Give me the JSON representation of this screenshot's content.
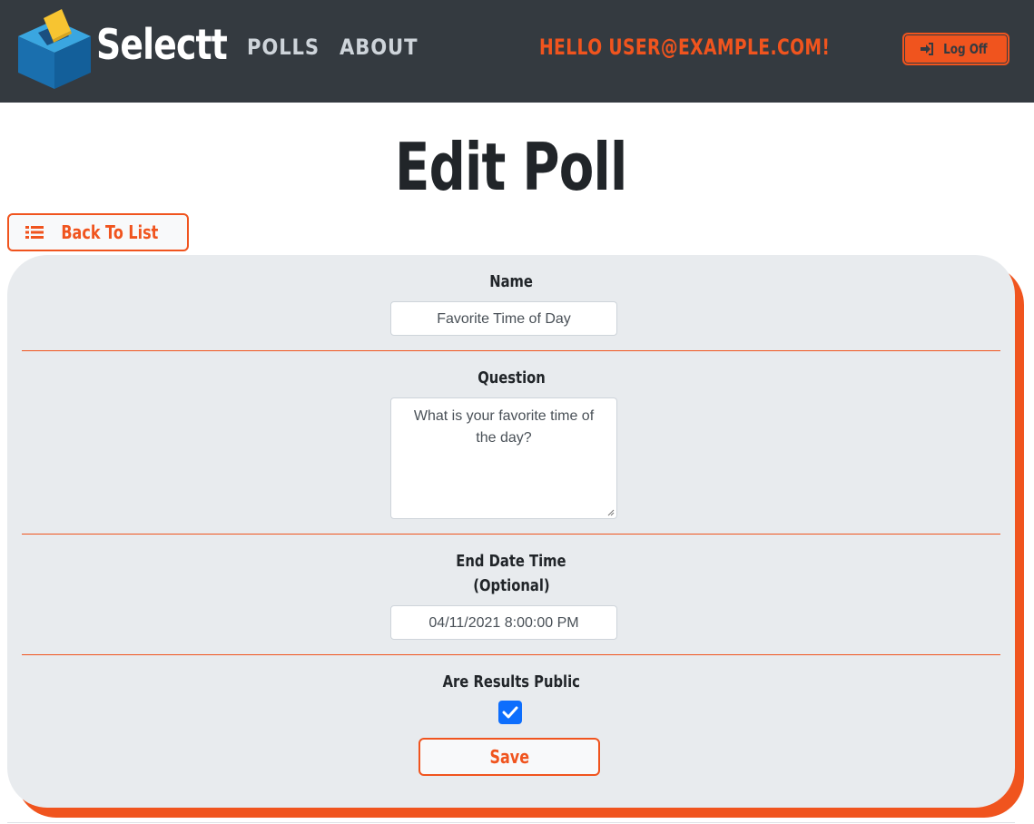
{
  "navbar": {
    "brand": "Selectt",
    "links": [
      {
        "label": "POLLS"
      },
      {
        "label": "ABOUT"
      }
    ],
    "greeting": "HELLO USER@EXAMPLE.COM!",
    "logoff_label": "Log Off"
  },
  "page": {
    "title": "Edit Poll",
    "back_label": "Back To List"
  },
  "form": {
    "name": {
      "label": "Name",
      "value": "Favorite Time of Day"
    },
    "question": {
      "label": "Question",
      "value": "What is your favorite time of the day?"
    },
    "end_date": {
      "label": "End Date Time",
      "sublabel": "(Optional)",
      "value": "04/11/2021 8:00:00 PM"
    },
    "results_public": {
      "label": "Are Results Public",
      "checked": true
    },
    "save_label": "Save"
  },
  "colors": {
    "navbar_bg": "#343a40",
    "accent": "#f0541e",
    "card_bg": "#e8ebee",
    "checkbox": "#0d6efd"
  }
}
